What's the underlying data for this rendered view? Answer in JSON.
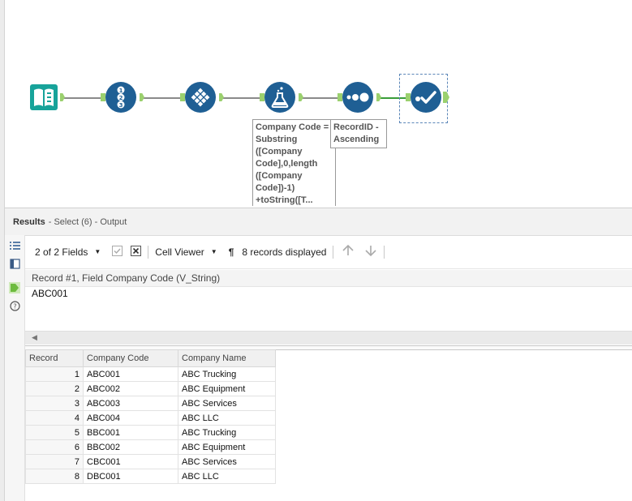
{
  "workflow": {
    "formula_annotation": [
      "Company Code =",
      "Substring",
      "([Company",
      "Code],0,length",
      "([Company",
      "Code])-1)",
      "+toString([T..."
    ],
    "sort_annotation": [
      "RecordID -",
      "Ascending"
    ],
    "colors": {
      "tool_blue": "#1f5f94",
      "input_green": "#17a39a",
      "anchor_green": "#9bd06e",
      "connector_gray": "#8a8a8a"
    },
    "tools": [
      {
        "name": "input-data-tool",
        "icon": "book-icon"
      },
      {
        "name": "record-id-tool",
        "icon": "numbered-list-icon"
      },
      {
        "name": "select-tool",
        "icon": "diamond-grid-icon"
      },
      {
        "name": "formula-tool",
        "icon": "flask-icon"
      },
      {
        "name": "sort-tool",
        "icon": "dots-icon"
      },
      {
        "name": "browse-tool",
        "icon": "checkmark-icon"
      }
    ]
  },
  "results": {
    "title": "Results",
    "subtitle": "- Select (6) - Output"
  },
  "toolbar": {
    "fields": "2 of 2 Fields",
    "viewer": "Cell Viewer",
    "records": "8 records displayed"
  },
  "cell": {
    "header": "Record #1, Field Company Code (V_String)",
    "value": "ABC001"
  },
  "table": {
    "columns": [
      "Record",
      "Company Code",
      "Company Name"
    ],
    "rows": [
      [
        "1",
        "ABC001",
        "ABC Trucking"
      ],
      [
        "2",
        "ABC002",
        "ABC Equipment"
      ],
      [
        "3",
        "ABC003",
        "ABC Services"
      ],
      [
        "4",
        "ABC004",
        "ABC LLC"
      ],
      [
        "5",
        "BBC001",
        "ABC Trucking"
      ],
      [
        "6",
        "BBC002",
        "ABC Equipment"
      ],
      [
        "7",
        "CBC001",
        "ABC Services"
      ],
      [
        "8",
        "DBC001",
        "ABC LLC"
      ]
    ]
  }
}
